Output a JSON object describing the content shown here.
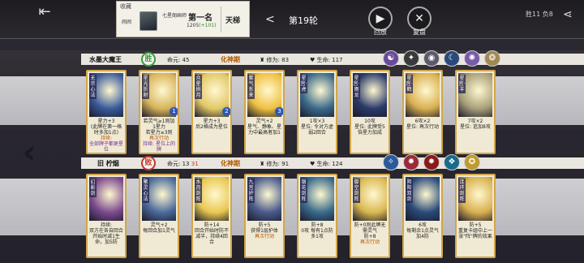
{
  "header": {
    "back_label": "⇤",
    "collect_title": "收藏",
    "collect_player": "闹闹",
    "collect_rank": "七星阁画师",
    "collect_place": "第一名",
    "collect_score": "1205",
    "collect_gain": "(+101)",
    "collect_ladder": "天梯",
    "round_arrow": "<",
    "round_label": "第19轮",
    "replay_label": "回放",
    "review_label": "复盘",
    "record": "胜11 负8"
  },
  "players": [
    {
      "name": "水墨大魔王",
      "result": "胜",
      "life_label": "命元: ",
      "life": "45",
      "life_extra": "",
      "realm": "化神期",
      "cult_label": "修为: ",
      "cult": "83",
      "hp_label": "生命: ",
      "hp": "117",
      "cards": [
        {
          "name": "无宗心法",
          "badge": "",
          "t1": "星力+3",
          "t2": "(此牌在第一格时多加1点)",
          "t3": "持续:",
          "t3b": "全部牌子都更星位",
          "art": "#3a5a9a"
        },
        {
          "name": "星光折射",
          "badge": "1",
          "t1": "若灵气≥1则加1星力",
          "t2": "若星力≥3则",
          "t3": "再次行动",
          "t3b": "持续: 星位上的牌",
          "art": "#d7b35a"
        },
        {
          "name": "众星拱月",
          "badge": "2",
          "t1": "星力+3",
          "t2": "后2格成为星位",
          "t3": "",
          "t3b": "",
          "art": "#e2c866"
        },
        {
          "name": "紫气东来",
          "badge": "3",
          "t1": "灵气+2",
          "t2": "星气、静象、星力中最高者加1",
          "t3": "",
          "t3b": "",
          "art": "#f0c040"
        },
        {
          "name": "星宫·虎",
          "badge": "",
          "t1": "1攻×3",
          "t2": "星位: 令对方虚弱2回合",
          "t3": "",
          "t3b": "",
          "art": "#3b6a8a"
        },
        {
          "name": "星宫·雨龙",
          "badge": "",
          "t1": "10攻",
          "t2": "星位: 此牌受5倍星力加成",
          "t3": "",
          "t3b": "",
          "art": "#2a3a6a"
        },
        {
          "name": "星宫·鹤",
          "badge": "",
          "t1": "6攻×2",
          "t2": "星位: 再次行动",
          "t3": "",
          "t3b": "",
          "art": "#d9b050"
        },
        {
          "name": "星宫·羊",
          "badge": "",
          "t1": "7攻×2",
          "t2": "星位: 追加8攻",
          "t3": "",
          "t3b": "",
          "art": "#a9a07a"
        }
      ],
      "skills": [
        "☯",
        "✦",
        "◉",
        "☾",
        "✺",
        "❂"
      ]
    },
    {
      "name": "旧  柠烟",
      "result": "败",
      "life_label": "命元: ",
      "life": "13",
      "life_extra": "31",
      "realm": "化神期",
      "cult_label": "修为: ",
      "cult": "91",
      "hp_label": "生命: ",
      "hp": "124",
      "cards": [
        {
          "name": "幻影剑",
          "badge": "",
          "t1": "持续:",
          "t2": "双方在各自回合开始时减1生命，加5防",
          "t3": "",
          "t3b": "",
          "art": "#7c4a8e"
        },
        {
          "name": "聚灵心法",
          "badge": "",
          "t1": "灵气+2",
          "t2": "每回合加1灵气",
          "t3": "",
          "t3b": "",
          "art": "#4a6a9a"
        },
        {
          "name": "水月剑阵",
          "badge": "",
          "t1": "防+14",
          "t2": "回合开始时防不减半，持续4回合",
          "t3": "",
          "t3b": "",
          "art": "#e8c850"
        },
        {
          "name": "九宫护阵",
          "badge": "",
          "t1": "防+5",
          "t2": "获得1层护体",
          "t3": "再次行动",
          "t3b": "",
          "art": "#4a5a8a"
        },
        {
          "name": "银花剑阵",
          "badge": "",
          "t1": "防+8",
          "t2": "0攻  每有1点防多1攻",
          "t3": "",
          "t3b": "",
          "art": "#3a6a8a"
        },
        {
          "name": "御空剑阵",
          "badge": "",
          "t1": "防+0则此牌无需灵气",
          "t2": "防+8",
          "t3": "再次行动",
          "t3b": "",
          "art": "#d9b850"
        },
        {
          "name": "阴阳双剑",
          "badge": "",
          "t1": "6攻",
          "t2": "每剩余1点灵气加4防",
          "t3": "",
          "t3b": "",
          "art": "#2a4a7a"
        },
        {
          "name": "连环剑阵",
          "badge": "",
          "t1": "防+5",
          "t2": "重复卡组中上一张\"阵\"牌的效果",
          "t3": "",
          "t3b": "",
          "art": "#d9b050"
        }
      ],
      "skills": [
        "✧",
        "✹",
        "✸",
        "❖",
        "✪"
      ]
    }
  ]
}
